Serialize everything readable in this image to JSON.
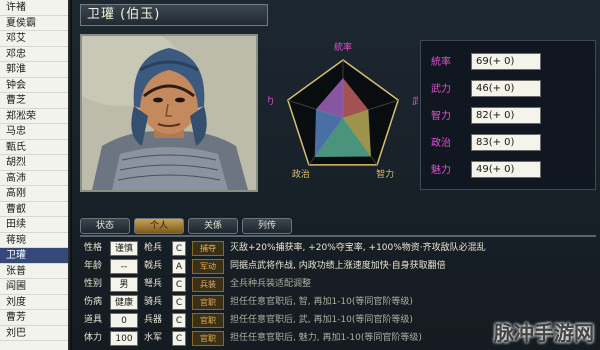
{
  "roster": [
    "许褚",
    "夏侯霸",
    "邓艾",
    "邓忠",
    "郭淮",
    "钟会",
    "曹芝",
    "郑淞荣",
    "马忠",
    "甄氏",
    "胡烈",
    "高沛",
    "高刚",
    "曹叡",
    "田续",
    "蒋琬",
    "卫瓘",
    "张普",
    "阎圃",
    "刘度",
    "曹芳",
    "刘巴"
  ],
  "selected_index": 16,
  "name": "卫瓘 (伯玉)",
  "radar": {
    "labels": {
      "top": "統率",
      "right": "武力",
      "bottom_right": "智力",
      "bottom_left": "政治",
      "left": "魅力"
    },
    "values": {
      "tong": 69,
      "wu": 46,
      "zhi": 82,
      "zheng": 83,
      "mei": 49
    }
  },
  "stats": [
    {
      "label": "統率",
      "value": "69(+ 0)"
    },
    {
      "label": "武力",
      "value": "46(+ 0)"
    },
    {
      "label": "智力",
      "value": "82(+ 0)"
    },
    {
      "label": "政治",
      "value": "83(+ 0)"
    },
    {
      "label": "魅力",
      "value": "49(+ 0)"
    }
  ],
  "tabs": [
    "状态",
    "个人",
    "关係",
    "列传"
  ],
  "active_tab": 1,
  "detail": [
    {
      "a_label": "性格",
      "a_val": "谨慎",
      "b_label": "枪兵",
      "b_val": "C",
      "tag": "捕夺",
      "desc": "灭敌+20%捕获率, +20%夺宝率, +100%物资·齐攻敌队必混乱",
      "dim": false
    },
    {
      "a_label": "年龄",
      "a_val": "--",
      "b_label": "戟兵",
      "b_val": "A",
      "tag": "军动",
      "desc": "同据点武将作战, 内政功绩上涨速度加快·自身获取翻倍",
      "dim": false
    },
    {
      "a_label": "性别",
      "a_val": "男",
      "b_label": "弩兵",
      "b_val": "C",
      "tag": "兵装",
      "desc": "全兵种兵装适配调整",
      "dim": true
    },
    {
      "a_label": "伤病",
      "a_val": "健康",
      "b_label": "骑兵",
      "b_val": "C",
      "tag": "官职",
      "desc": "担任任意官职后, 智, 再加1-10(等同官阶等级)",
      "dim": true
    },
    {
      "a_label": "道具",
      "a_val": "0",
      "b_label": "兵器",
      "b_val": "C",
      "tag": "官职",
      "desc": "担任任意官职后, 武, 再加1-10(等同官阶等级)",
      "dim": true
    },
    {
      "a_label": "体力",
      "a_val": "100",
      "b_label": "水军",
      "b_val": "C",
      "tag": "官职",
      "desc": "担任任意官职后, 魅力, 再加1-10(等同官阶等级)",
      "dim": true
    }
  ],
  "watermark": "脉冲手游网",
  "colors": {
    "accent_gold": "#c9a450",
    "label_magenta": "#e050d0",
    "radar_line": "#d8c070",
    "selected_row": "#34497a"
  }
}
